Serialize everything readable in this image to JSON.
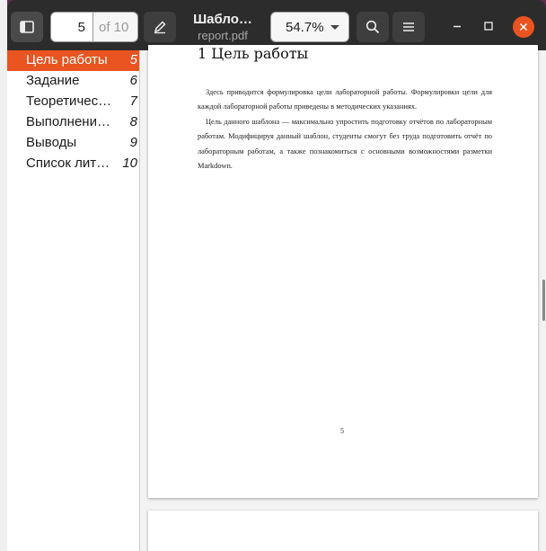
{
  "header": {
    "current_page": "5",
    "page_total": "of 10",
    "title": "Шабло…",
    "filename": "report.pdf",
    "zoom": "54.7%"
  },
  "outline": [
    {
      "label": "Цель работы",
      "page": "5",
      "selected": true
    },
    {
      "label": "Задание",
      "page": "6",
      "selected": false
    },
    {
      "label": "Теоретичес…",
      "page": "7",
      "selected": false
    },
    {
      "label": "Выполнени…",
      "page": "8",
      "selected": false
    },
    {
      "label": "Выводы",
      "page": "9",
      "selected": false
    },
    {
      "label": "Список лит…",
      "page": "10",
      "selected": false
    }
  ],
  "document": {
    "heading": "1  Цель работы",
    "para1": "Здесь приводится формулировка цели лабораторной работы. Формулировки цели для каждой лабораторной работы приведены в методических указаниях.",
    "para2": "Цель данного шаблона — максимально упростить подготовку отчётов по лабораторным работам. Модифицируя данный шаблон, студенты смогут без труда подготовить отчёт по лабораторным работам, а также познакомиться с основными возможностями разметки Markdown.",
    "page_number": "5"
  },
  "colors": {
    "accent": "#e95420",
    "header_bg": "#2c2c2c"
  },
  "icons": [
    "sidebar-icon",
    "pencil-icon",
    "search-icon",
    "hamburger-menu-icon",
    "minimize-icon",
    "maximize-icon",
    "close-icon",
    "mouse-pointer-icon"
  ]
}
